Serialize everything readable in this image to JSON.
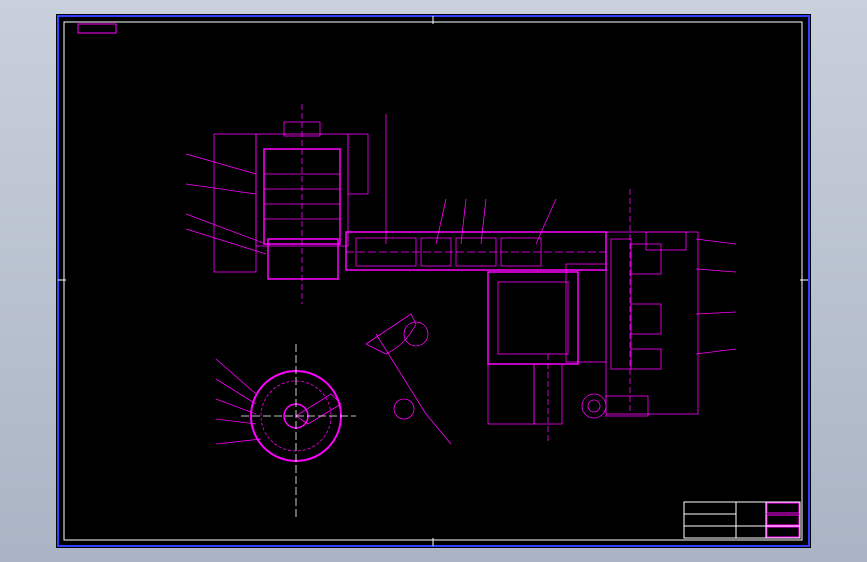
{
  "sheet": {
    "background": "#000000",
    "line_color": "#ff00ff",
    "border_color": "#0000ff",
    "frame_color": "#ffffff"
  },
  "title_block": {
    "line_1": "",
    "line_2": "",
    "line_3": ""
  }
}
